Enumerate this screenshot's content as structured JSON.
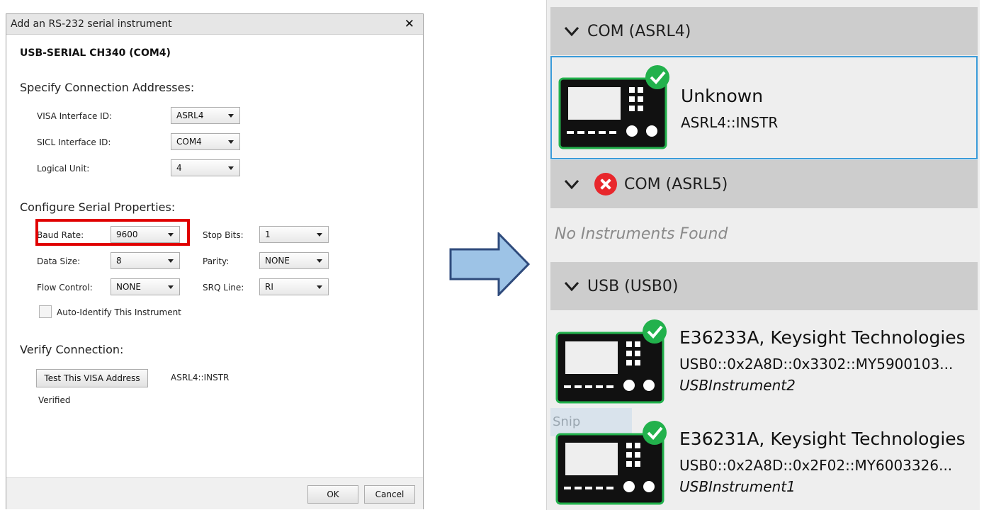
{
  "dialog": {
    "title": "Add an RS-232 serial instrument",
    "device_name": "USB-SERIAL CH340 (COM4)",
    "connection_section": {
      "title": "Specify Connection Addresses:",
      "visa_label": "VISA Interface ID:",
      "visa_value": "ASRL4",
      "sicl_label": "SICL Interface ID:",
      "sicl_value": "COM4",
      "logical_label": "Logical Unit:",
      "logical_value": "4"
    },
    "serial_section": {
      "title": "Configure Serial Properties:",
      "baud_label": "Baud Rate:",
      "baud_value": "9600",
      "stop_label": "Stop Bits:",
      "stop_value": "1",
      "data_label": "Data Size:",
      "data_value": "8",
      "parity_label": "Parity:",
      "parity_value": "NONE",
      "flow_label": "Flow Control:",
      "flow_value": "NONE",
      "srq_label": "SRQ Line:",
      "srq_value": "RI",
      "auto_identify_label": "Auto-Identify This Instrument"
    },
    "verify_section": {
      "title": "Verify Connection:",
      "test_button": "Test This VISA Address",
      "address": "ASRL4::INSTR",
      "status": "Verified"
    },
    "ok_button": "OK",
    "cancel_button": "Cancel"
  },
  "panel": {
    "groups": [
      {
        "title": "COM (ASRL4)"
      },
      {
        "title": "COM (ASRL5)",
        "empty_text": "No Instruments Found"
      },
      {
        "title": "USB (USB0)"
      }
    ],
    "instruments": [
      {
        "name": "Unknown",
        "address": "ASRL4::INSTR"
      },
      {
        "name": "E36233A, Keysight Technologies",
        "address": "USB0::0x2A8D::0x3302::MY5900103...",
        "alias": "USBInstrument2"
      },
      {
        "name": "E36231A, Keysight Technologies",
        "address": "USB0::0x2A8D::0x2F02::MY6003326...",
        "alias": "USBInstrument1"
      }
    ],
    "snip_label": "Snip"
  },
  "colors": {
    "highlight": "#e00000",
    "arrow_fill": "#9dc3e6",
    "arrow_stroke": "#2f4b7c",
    "ok_check": "#22b14c",
    "error": "#e8272c",
    "selection": "#3a9bd9"
  },
  "icons": [
    "close-icon",
    "chevron-down-icon",
    "check-badge-icon",
    "error-icon",
    "instrument-icon",
    "right-arrow-icon"
  ]
}
